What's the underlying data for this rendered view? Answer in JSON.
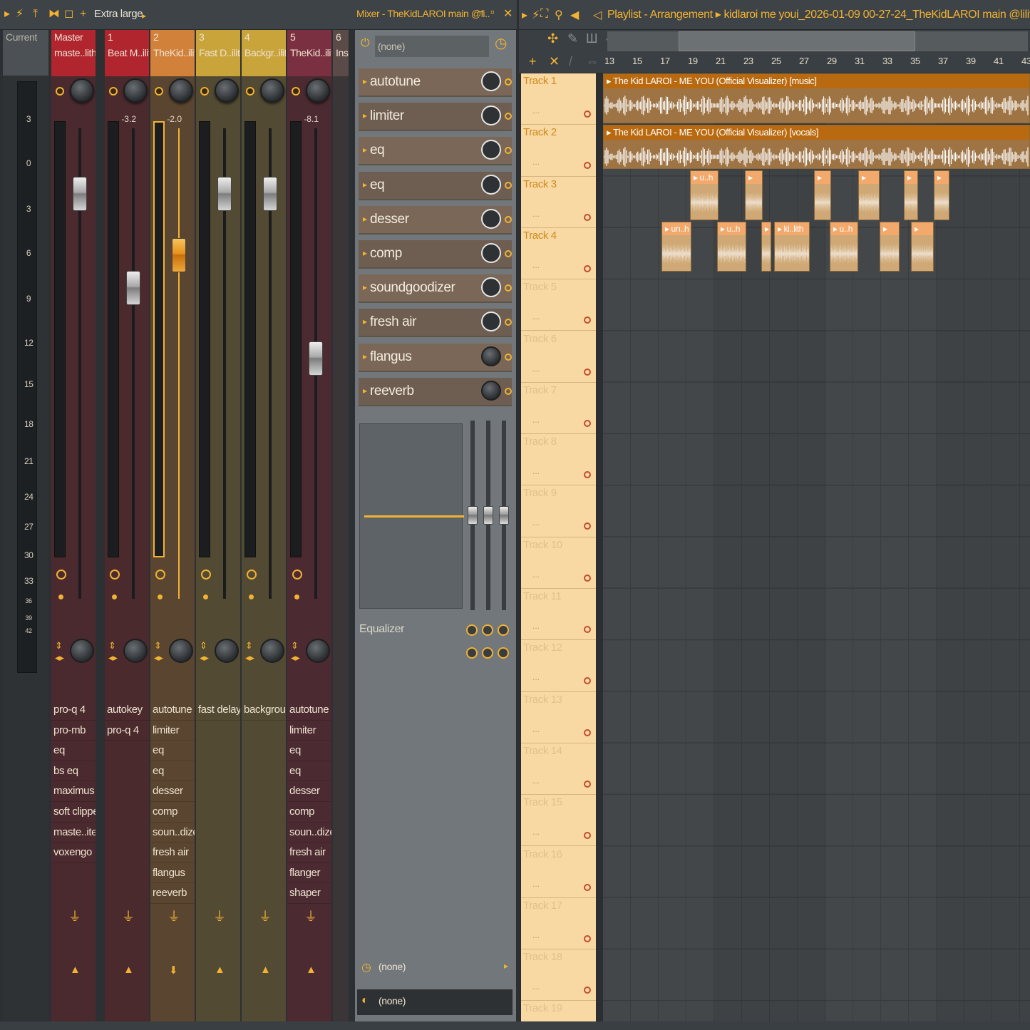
{
  "mixer": {
    "toolbar": {
      "preset": "Extra large",
      "title": "Mixer - TheKidLAROI main @li.."
    },
    "current_label": "Current",
    "scale": [
      "3",
      "0",
      "3",
      "6",
      "9",
      "12",
      "15",
      "18",
      "21",
      "24",
      "27",
      "30",
      "33",
      "36",
      "39",
      "42"
    ],
    "strips": [
      {
        "num": "",
        "name": "Master",
        "sub": "maste..lith",
        "color": "#b0252e",
        "body": "#4a2a2e",
        "vol": "",
        "fader": 0.14,
        "fx": [
          "pro-q 4",
          "pro-mb",
          "eq",
          "bs eq",
          "maximus",
          "soft clipper",
          "maste..iter",
          "voxengo"
        ]
      },
      {
        "num": "1",
        "name": "Beat M..ilith",
        "sub": "",
        "color": "#b0252e",
        "body": "#4b2a2e",
        "vol": "-3.2",
        "fader": 0.34,
        "fx": [
          "autokey",
          "pro-q 4"
        ]
      },
      {
        "num": "2",
        "name": "TheKid..ilith",
        "sub": "",
        "color": "#d2813b",
        "body": "#5a4530",
        "vol": "-2.0",
        "fader": 0.27,
        "selected": true,
        "fx": [
          "autotune",
          "limiter",
          "eq",
          "eq",
          "desser",
          "comp",
          "soun..dizer",
          "fresh air",
          "flangus",
          "reeverb"
        ]
      },
      {
        "num": "3",
        "name": "Fast D..ilith",
        "sub": "",
        "color": "#c8a43a",
        "body": "#524a32",
        "vol": "",
        "fader": 0.14,
        "fx": [
          "fast delay"
        ]
      },
      {
        "num": "4",
        "name": "Backgr..ilith",
        "sub": "",
        "color": "#c8a43a",
        "body": "#524a32",
        "vol": "",
        "fader": 0.14,
        "fx": [
          "background"
        ]
      },
      {
        "num": "5",
        "name": "TheKid..ilith",
        "sub": "",
        "color": "#7a3040",
        "body": "#4b2a32",
        "vol": "-8.1",
        "fader": 0.49,
        "fx": [
          "autotune",
          "limiter",
          "eq",
          "eq",
          "desser",
          "comp",
          "soun..dizer",
          "fresh air",
          "flanger",
          "shaper"
        ]
      },
      {
        "num": "6",
        "name": "Ins",
        "sub": "",
        "color": "#5a4a48",
        "body": "#3a3638",
        "vol": "",
        "fader": 0.0,
        "fx": []
      }
    ]
  },
  "fx_panel": {
    "input": "(none)",
    "slots": [
      "autotune",
      "limiter",
      "eq",
      "eq",
      "desser",
      "comp",
      "soundgoodizer",
      "fresh air",
      "flangus",
      "reeverb"
    ],
    "eq_label": "Equalizer",
    "send": "(none)",
    "output": "(none)"
  },
  "playlist": {
    "title": "Playlist - Arrangement",
    "project": "kidlaroi me youi_2026-01-09 00-27-24_TheKidLAROI main @lilith",
    "ruler": [
      "13",
      "15",
      "17",
      "19",
      "21",
      "23",
      "25",
      "27",
      "29",
      "31",
      "33",
      "35",
      "37",
      "39",
      "41",
      "43"
    ],
    "tracks": [
      "Track 1",
      "Track 2",
      "Track 3",
      "Track 4",
      "Track 5",
      "Track 6",
      "Track 7",
      "Track 8",
      "Track 9",
      "Track 10",
      "Track 11",
      "Track 12",
      "Track 13",
      "Track 14",
      "Track 15",
      "Track 16",
      "Track 17",
      "Track 18",
      "Track 19"
    ],
    "clips": {
      "music": "The Kid LAROI - ME  YOU (Official Visualizer) [music]",
      "vocals": "The Kid LAROI - ME  YOU (Official Visualizer) [vocals]",
      "track3": [
        "u..h",
        "",
        "",
        "",
        "",
        ""
      ],
      "track4": [
        "un..h",
        "u..h",
        "ki..lith",
        "u..h",
        "",
        ""
      ]
    }
  }
}
